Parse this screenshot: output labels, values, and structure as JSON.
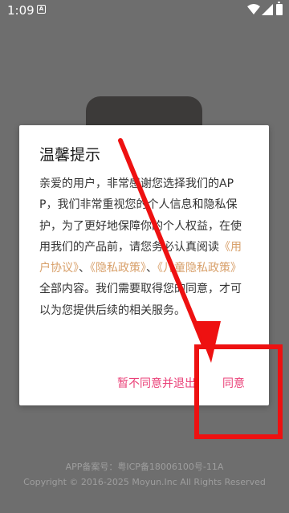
{
  "status_bar": {
    "time": "1:09",
    "notification_badge": "A",
    "icons": [
      "wifi-icon",
      "signal-icon",
      "battery-icon"
    ]
  },
  "dialog": {
    "title": "温馨提示",
    "body_parts": [
      "亲爱的用户，非常感谢您选择我们的APP，我们非常重视您的个人信息和隐私保护，为了更好地保障你的个人权益，在使用我们的产品前，请您务必认真阅读",
      "《用户协议》",
      "、",
      "《隐私政策》",
      "、",
      "《儿童隐私政策》",
      "全部内容。我们需要取得您的同意，才可以为您提供后续的相关服务。"
    ],
    "disagree_label": "暂不同意并退出",
    "agree_label": "同意"
  },
  "footer": {
    "icp": "APP备案号：粤ICP备18006100号-11A",
    "copyright": "Copyright © 2016-2025 Moyun.Inc All Rights Reserved"
  },
  "colors": {
    "scrim": "#6e6e6e",
    "accent_button": "#ea3f77",
    "link": "#d8a06a",
    "annotation": "#ee1111"
  }
}
